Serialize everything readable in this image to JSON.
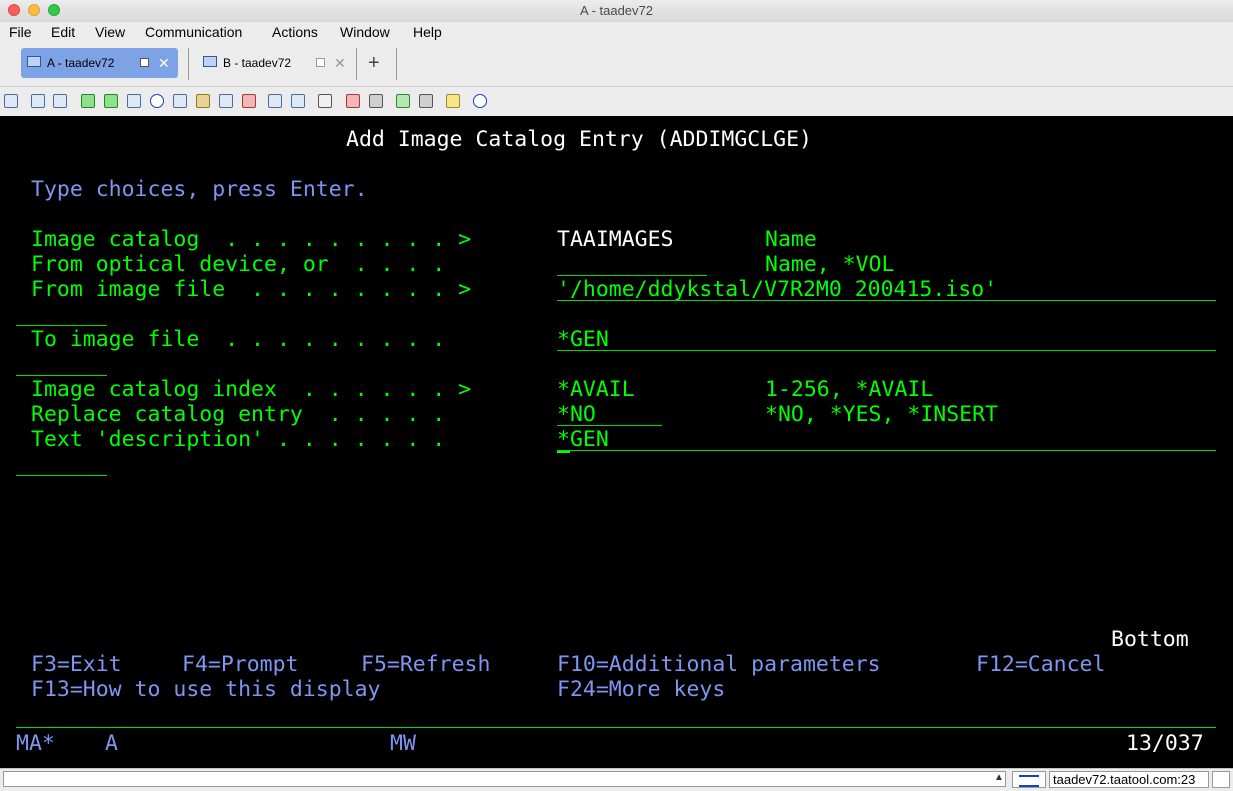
{
  "window": {
    "title": "A - taadev72"
  },
  "menu": [
    "File",
    "Edit",
    "View",
    "Communication",
    "Actions",
    "Window",
    "Help"
  ],
  "tabs": [
    {
      "label": "A - taadev72",
      "active": true
    },
    {
      "label": "B - taadev72",
      "active": false
    }
  ],
  "add_tab_label": "+",
  "toolbar_icons": [
    "copy-icon",
    "copy-append-icon",
    "paste-icon",
    "send-file-icon",
    "receive-file-icon",
    "print-icon",
    "navigate-icon",
    "list-icon",
    "macro-icon",
    "record-icon",
    "play-icon",
    "keyboard-icon",
    "keypad-icon",
    "tools-icon",
    "edit-icon",
    "settings-icon",
    "stop-icon",
    "start-icon",
    "disconnect-icon",
    "notes-icon",
    "help-icon"
  ],
  "screen": {
    "title": "Add Image Catalog Entry (ADDIMGCLGE)",
    "instructions": "Type choices, press Enter.",
    "fields": [
      {
        "label": "Image catalog  . . . . . . . . . >",
        "value": "TAAIMAGES",
        "hint": "Name"
      },
      {
        "label": "From optical device, or  . . . .",
        "value": "",
        "hint": "Name, *VOL"
      },
      {
        "label": "From image file  . . . . . . . . >",
        "value": "'/home/ddykstal/V7R2M0_200415.iso'",
        "hint": ""
      },
      {
        "label": "To image file  . . . . . . . . .",
        "value": "*GEN",
        "hint": ""
      },
      {
        "label": "Image catalog index  . . . . . . >",
        "value": "*AVAIL",
        "hint": "1-256, *AVAIL"
      },
      {
        "label": "Replace catalog entry  . . . . .",
        "value": "*NO",
        "hint": "*NO, *YES, *INSERT"
      },
      {
        "label": "Text 'description' . . . . . . .",
        "value": "*GEN",
        "hint": ""
      }
    ],
    "bottom_label": "Bottom",
    "fkeys_row1": [
      {
        "label": "F3=Exit"
      },
      {
        "label": "F4=Prompt"
      },
      {
        "label": "F5=Refresh"
      },
      {
        "label": "F10=Additional parameters"
      },
      {
        "label": "F12=Cancel"
      }
    ],
    "fkeys_row2": [
      {
        "label": "F13=How to use this display"
      },
      {
        "label": "F24=More keys"
      }
    ],
    "oia": {
      "left": "MA*",
      "session": "A",
      "mode": "MW",
      "cursor_pos": "13/037"
    }
  },
  "status": {
    "host": "taadev72.taatool.com:23"
  }
}
